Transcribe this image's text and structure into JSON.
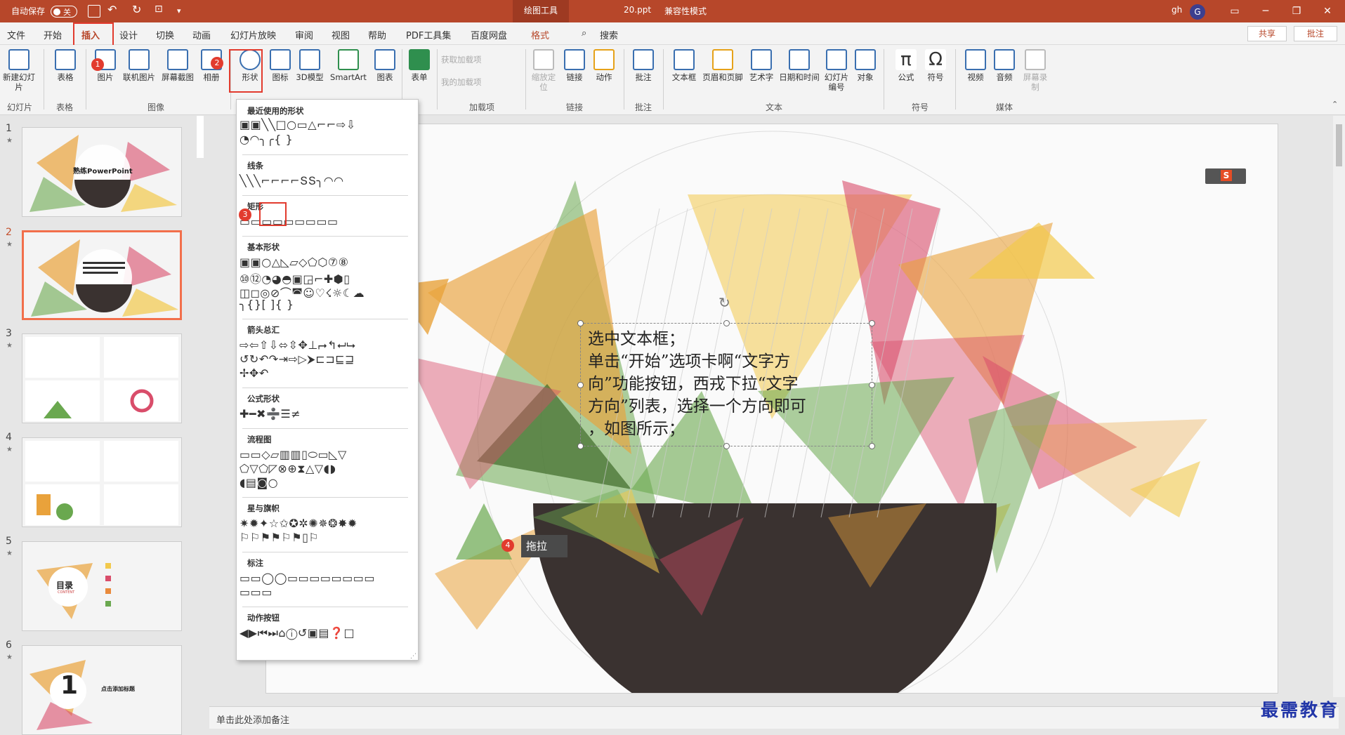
{
  "titlebar": {
    "autosave_label": "自动保存",
    "autosave_state": "关",
    "context_tab": "绘图工具",
    "doc_title": "20.ppt",
    "mode": "兼容性模式",
    "user": "gh",
    "avatar": "G"
  },
  "menu": {
    "tabs": [
      "文件",
      "开始",
      "插入",
      "设计",
      "切换",
      "动画",
      "幻灯片放映",
      "审阅",
      "视图",
      "帮助",
      "PDF工具集",
      "百度网盘",
      "格式"
    ],
    "search": "搜索",
    "share": "共享",
    "comment": "批注"
  },
  "ribbon": {
    "buttons": [
      "新建幻灯片",
      "表格",
      "图片",
      "联机图片",
      "屏幕截图",
      "相册",
      "形状",
      "图标",
      "3D模型",
      "SmartArt",
      "图表",
      "表单",
      "获取加载项",
      "我的加载项",
      "缩放定位",
      "链接",
      "动作",
      "批注",
      "文本框",
      "页眉和页脚",
      "艺术字",
      "日期和时间",
      "幻灯片编号",
      "对象",
      "公式",
      "符号",
      "视频",
      "音频",
      "屏幕录制"
    ],
    "groups": [
      "幻灯片",
      "表格",
      "图像",
      "加载项",
      "链接",
      "批注",
      "文本",
      "符号",
      "媒体"
    ]
  },
  "slides": {
    "numbers": [
      "1",
      "2",
      "3",
      "4",
      "5",
      "6"
    ],
    "selected": 2,
    "titles": {
      "s1": "熟练PowerPoint",
      "s5": "目录",
      "s5_sub": "CONTENT",
      "s6_num": "1",
      "s6": "点击添加标题"
    }
  },
  "shapes_menu": {
    "sections": [
      "最近使用的形状",
      "线条",
      "矩形",
      "基本形状",
      "箭头总汇",
      "公式形状",
      "流程图",
      "星与旗帜",
      "标注",
      "动作按钮"
    ]
  },
  "slide_text": [
    "选中文本框；",
    "单击“开始”选项卡啊“文字方",
    "向”功能按钮，西戎下拉“文字",
    "方向”列表，选择一个方向即可",
    "，如图所示；"
  ],
  "callouts": [
    "1",
    "2",
    "3",
    "4"
  ],
  "drag_label": "拖拉",
  "notes_placeholder": "单击此处添加备注",
  "watermark": "最需教育",
  "colors": {
    "accent": "#b7472a",
    "marker": "#e23b2e"
  }
}
